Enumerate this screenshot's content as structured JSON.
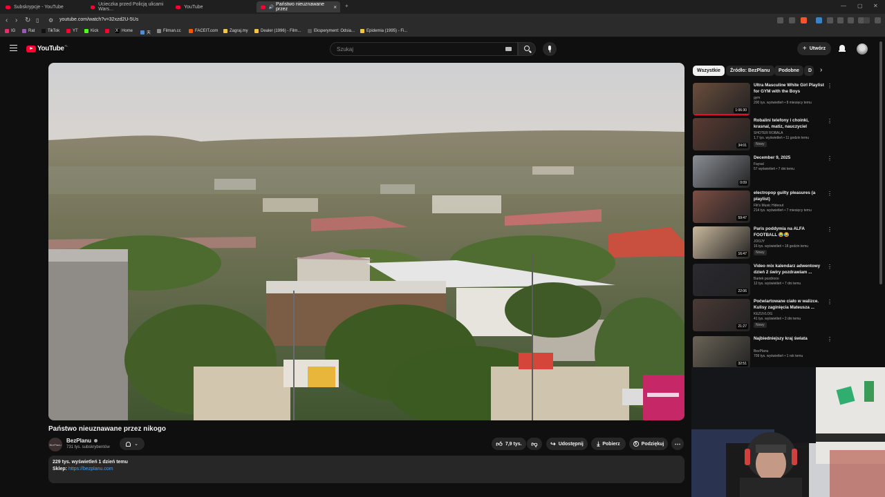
{
  "browser": {
    "tabs": [
      {
        "label": "Subskrypcje - YouTube"
      },
      {
        "label": "Ucieczka przed Policją ulicami Wars..."
      },
      {
        "label": "YouTube"
      },
      {
        "label": "Państwo nieuznawane przez"
      }
    ],
    "url": "youtube.com/watch?v=32xzd2U-5Us",
    "bookmarks": [
      {
        "label": "IG",
        "color": "#e1306c"
      },
      {
        "label": "Rat",
        "color": "#9b59b6"
      },
      {
        "label": "TikTok",
        "color": "#111111"
      },
      {
        "label": "YT",
        "color": "#ff0033"
      },
      {
        "label": "Kick",
        "color": "#53fc18"
      },
      {
        "label": "",
        "color": "#ff0033"
      },
      {
        "label": "Home",
        "color": "#000000"
      },
      {
        "label": "天",
        "color": "#4a90d9"
      },
      {
        "label": "Filman.cc",
        "color": "#888888"
      },
      {
        "label": "FACEIT.com",
        "color": "#ff5500"
      },
      {
        "label": "Zagraj.my",
        "color": "#f5c542"
      },
      {
        "label": "Dealer (1996) - Film...",
        "color": "#f5c542"
      },
      {
        "label": "Eksperyment: Odsia...",
        "color": "#555555"
      },
      {
        "label": "Epidemia (1995) - Fi...",
        "color": "#f5c542"
      }
    ]
  },
  "youtube": {
    "logo": "YouTube",
    "logo_region": "PL",
    "search_placeholder": "Szukaj",
    "create_label": "Utwórz",
    "accent": "#ff0033"
  },
  "video": {
    "title": "Państwo nieuznawane przez nikogo",
    "channel": "BezPlanu",
    "avatar_text": "BezPlanu",
    "subscribers": "731 tys. subskrybentów",
    "likes": "7,9 tys.",
    "share_label": "Udostępnij",
    "download_label": "Pobierz",
    "thanks_label": "Podziękuj",
    "description": {
      "stats": "229 tys. wyświetleń  1 dzień temu",
      "shop_label": "Sklep:",
      "shop_link": "https://bezplanu.com"
    }
  },
  "chips": [
    {
      "label": "Wszystkie",
      "selected": true
    },
    {
      "label": "Źródło: BezPlanu",
      "selected": false
    },
    {
      "label": "Podobne",
      "selected": false
    },
    {
      "label": "D",
      "selected": false
    }
  ],
  "recommendations": [
    {
      "title": "Ultra Masculine White Girl Playlist for GYM with the Boys",
      "channel": "gym",
      "meta": "200 tys. wyświetleń • 8 miesięcy temu",
      "duration": "1:06:30",
      "badge": "",
      "thumb_color": "#6b4e3d"
    },
    {
      "title": "Robalini telefony i choinki, krasnal, matiz, nauczyciel",
      "channel": "SHOTER ROBALA",
      "meta": "1,7 tys. wyświetleń • 11 godzin temu",
      "duration": "34:01",
      "badge": "Nowy",
      "thumb_color": "#5a3b32"
    },
    {
      "title": "December 9, 2025",
      "channel": "Faysal",
      "meta": "57 wyświetleń • 7 dni temu",
      "duration": "0:09",
      "badge": "",
      "thumb_color": "#8a8f95"
    },
    {
      "title": "electropop guilty pleasures (a playlist)",
      "channel": "Flit's Music Hideout",
      "meta": "214 tys. wyświetleń • 7 miesięcy temu",
      "duration": "59:47",
      "badge": "",
      "thumb_color": "#7d4e44"
    },
    {
      "title": "Paris poddymia na ALFA FOOTBALL 😂😂",
      "channel": "JOOJY",
      "meta": "16 tys. wyświetleń • 18 godzin temu",
      "duration": "16:47",
      "badge": "Nowy",
      "thumb_color": "#c9b89d"
    },
    {
      "title": "Video mix kalendarz adwentowy dzień 2 świry pozdrawiam ...",
      "channel": "Bartek pozdrooo",
      "meta": "12 tys. wyświetleń • 7 dni temu",
      "duration": "22:06",
      "badge": "",
      "thumb_color": "#2a2a30"
    },
    {
      "title": "Poćwiartowane ciało w walizce. Kulisy zaginięcia Mateusza ...",
      "channel": "KEZUVLOG",
      "meta": "41 tys. wyświetleń • 2 dni temu",
      "duration": "21:27",
      "badge": "Nowy",
      "thumb_color": "#4a3a35"
    },
    {
      "title": "Najbiedniejszy kraj świata",
      "channel": "BezPlanu",
      "meta": "709 tys. wyświetleń • 1 rok temu",
      "duration": "32:51",
      "badge": "",
      "thumb_color": "#6a6456"
    }
  ]
}
